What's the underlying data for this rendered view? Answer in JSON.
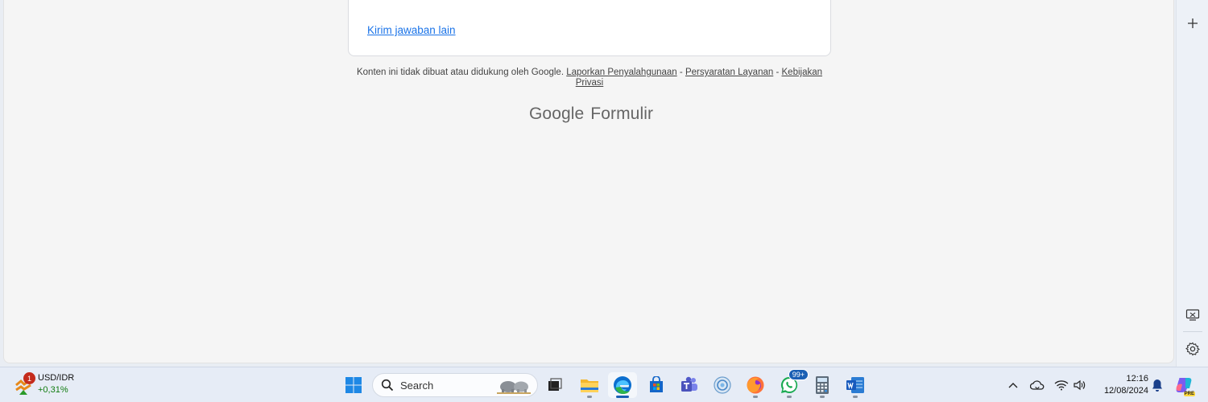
{
  "form": {
    "another_response_link": "Kirim jawaban lain",
    "footer_note_text": "Konten ini tidak dibuat atau didukung oleh Google.",
    "footer_links": [
      "Laporkan Penyalahgunaan",
      "Persyaratan Layanan",
      "Kebijakan Privasi"
    ],
    "separator": "-",
    "brand_google": "Google",
    "brand_product": "Formulir"
  },
  "sidepanel": {
    "icons": [
      "plus-icon",
      "screenshot-icon",
      "settings-gear-icon"
    ]
  },
  "taskbar": {
    "widget": {
      "badge": "1",
      "label": "USD/IDR",
      "change": "+0,31%"
    },
    "search_label": "Search",
    "apps": [
      {
        "name": "windows-start-icon",
        "active": false
      },
      {
        "name": "task-view-icon",
        "active": false
      },
      {
        "name": "file-explorer-icon",
        "active": false
      },
      {
        "name": "edge-browser-icon",
        "active": true
      },
      {
        "name": "microsoft-store-icon",
        "active": false
      },
      {
        "name": "teams-icon",
        "active": false
      },
      {
        "name": "control-panel-icon",
        "active": false
      },
      {
        "name": "firefox-icon",
        "active": false
      },
      {
        "name": "whatsapp-icon",
        "active": false,
        "badge": "99+"
      },
      {
        "name": "calculator-icon",
        "active": false
      },
      {
        "name": "word-icon",
        "active": false
      }
    ],
    "tray": {
      "time": "12:16",
      "date": "12/08/2024",
      "copilot_badge": "PRE"
    }
  }
}
